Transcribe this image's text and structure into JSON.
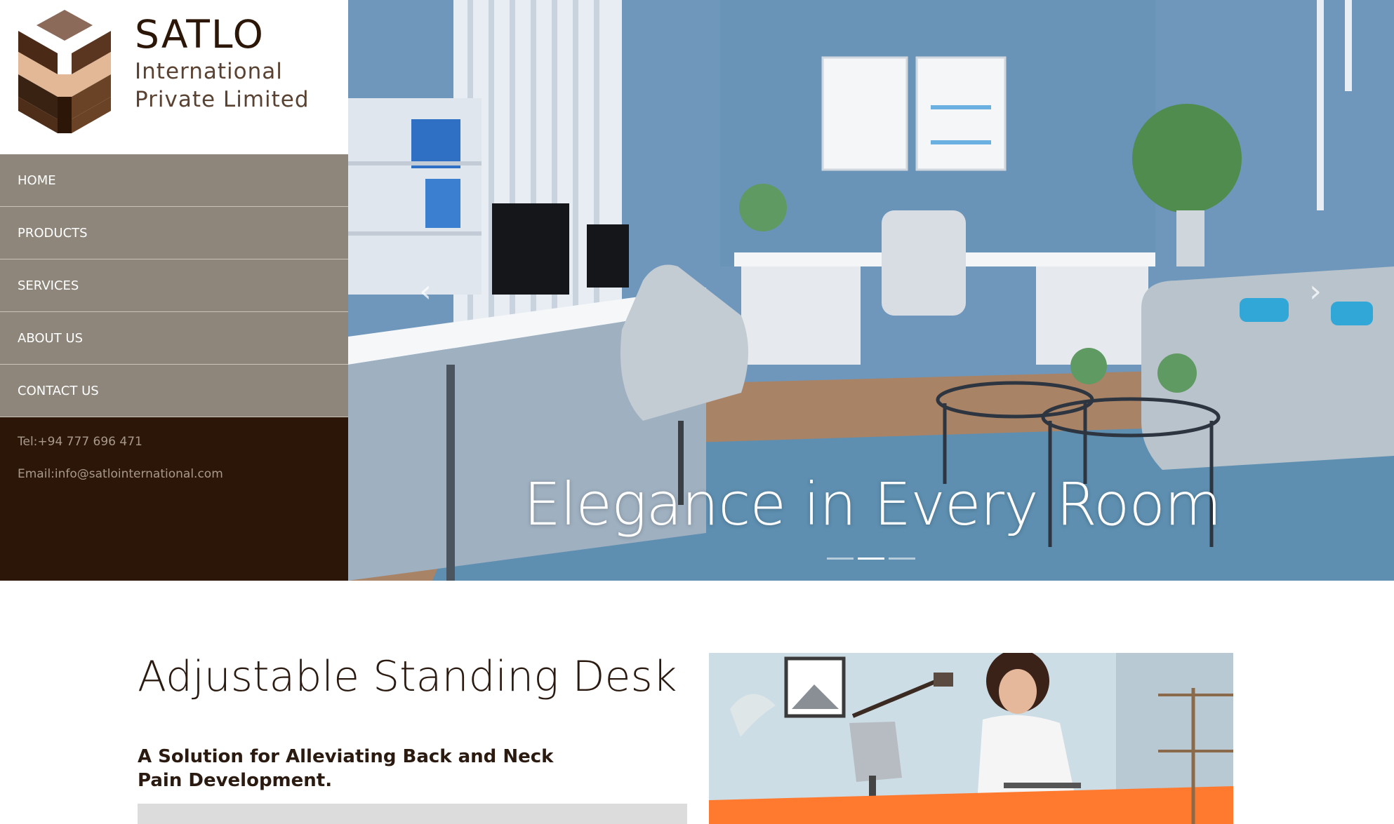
{
  "brand": {
    "name": "SATLO",
    "subtitle_line1": "International",
    "subtitle_line2": "Private Limited",
    "colors": {
      "dark_brown": "#2c1608",
      "taupe": "#8e867a",
      "tan": "#d9b08c"
    }
  },
  "nav": {
    "items": [
      {
        "label": "HOME"
      },
      {
        "label": "PRODUCTS"
      },
      {
        "label": "SERVICES"
      },
      {
        "label": "ABOUT US"
      },
      {
        "label": "CONTACT US"
      }
    ]
  },
  "contact": {
    "phone": "Tel:+94 777 696 471",
    "email": "Email:info@satlointernational.com"
  },
  "hero": {
    "caption": "Elegance in Every Room",
    "prev_icon": "chevron-left-icon",
    "next_icon": "chevron-right-icon",
    "prev_glyph": "‹",
    "next_glyph": "›",
    "active_slide": 1,
    "slide_count": 3
  },
  "feature": {
    "title": "Adjustable Standing Desk",
    "subtitle": "A Solution for Alleviating Back and Neck Pain Development."
  }
}
